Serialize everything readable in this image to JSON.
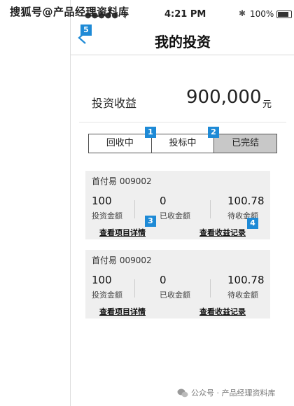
{
  "watermark_top": "搜狐号@产品经理资料库",
  "status_bar": {
    "carrier": "●●●●● 令",
    "time": "4:21 PM",
    "battery_text": "100%"
  },
  "nav": {
    "title": "我的投资"
  },
  "badges": [
    "1",
    "2",
    "3",
    "4",
    "5"
  ],
  "earnings": {
    "label": "投资收益",
    "amount": "900,000",
    "unit": "元"
  },
  "tabs": [
    {
      "label": "回收中",
      "active": false
    },
    {
      "label": "投标中",
      "active": false
    },
    {
      "label": "已完结",
      "active": true
    }
  ],
  "investments": [
    {
      "name": "首付易 009002",
      "invested": "100",
      "invested_label": "投资金额",
      "received": "0",
      "received_label": "已收金额",
      "pending": "100.78",
      "pending_label": "待收金额",
      "detail_link": "查看项目详情",
      "record_link": "查看收益记录"
    },
    {
      "name": "首付易 009002",
      "invested": "100",
      "invested_label": "投资金额",
      "received": "0",
      "received_label": "已收金额",
      "pending": "100.78",
      "pending_label": "待收金额",
      "detail_link": "查看项目详情",
      "record_link": "查看收益记录"
    }
  ],
  "watermark_bottom": "公众号 · 产品经理资料库",
  "colors": {
    "badge": "#1e8ad6",
    "active_tab": "#c8c8c8",
    "card_bg": "#efefef",
    "back_arrow": "#1e8ad6"
  }
}
